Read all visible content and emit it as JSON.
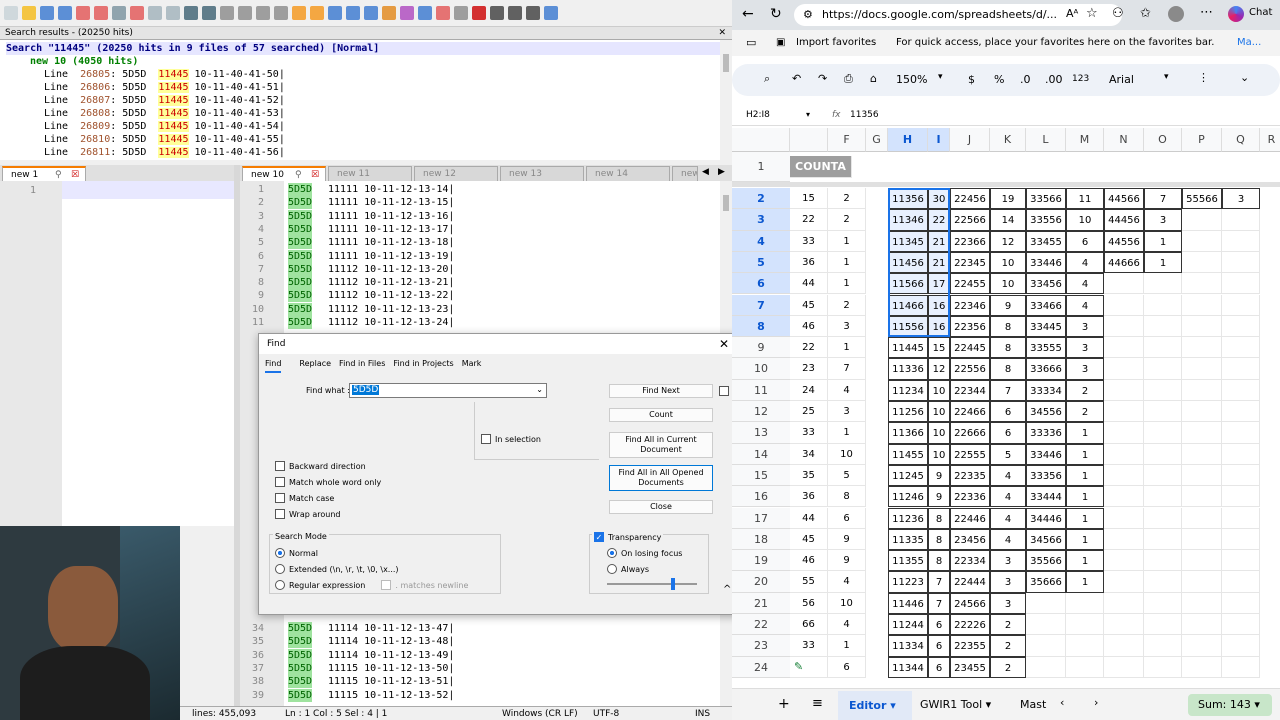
{
  "npp": {
    "search_header": "Search results - (20250 hits)",
    "search_summary": "Search \"11445\" (20250 hits in 9 files of 57 searched) [Normal]",
    "search_file": "new 10 (4050 hits)",
    "search_lines": [
      {
        "ln": "26805",
        "pre": "5D5D",
        "hit": "11445",
        "post": "10-11-40-41-50|"
      },
      {
        "ln": "26806",
        "pre": "5D5D",
        "hit": "11445",
        "post": "10-11-40-41-51|"
      },
      {
        "ln": "26807",
        "pre": "5D5D",
        "hit": "11445",
        "post": "10-11-40-41-52|"
      },
      {
        "ln": "26808",
        "pre": "5D5D",
        "hit": "11445",
        "post": "10-11-40-41-53|"
      },
      {
        "ln": "26809",
        "pre": "5D5D",
        "hit": "11445",
        "post": "10-11-40-41-54|"
      },
      {
        "ln": "26810",
        "pre": "5D5D",
        "hit": "11445",
        "post": "10-11-40-41-55|"
      },
      {
        "ln": "26811",
        "pre": "5D5D",
        "hit": "11445",
        "post": "10-11-40-41-56|"
      }
    ],
    "tabs_left": [
      {
        "label": "new 1"
      }
    ],
    "tabs_right": [
      {
        "label": "new 10"
      },
      {
        "label": "new 11"
      },
      {
        "label": "new 12"
      },
      {
        "label": "new 13"
      },
      {
        "label": "new 14"
      },
      {
        "label": "new"
      }
    ],
    "editor1_line": "1",
    "editor2_top": [
      {
        "n": "1",
        "a": "5D5D",
        "b": "11111 10-11-12-13-14|"
      },
      {
        "n": "2",
        "a": "5D5D",
        "b": "11111 10-11-12-13-15|"
      },
      {
        "n": "3",
        "a": "5D5D",
        "b": "11111 10-11-12-13-16|"
      },
      {
        "n": "4",
        "a": "5D5D",
        "b": "11111 10-11-12-13-17|"
      },
      {
        "n": "5",
        "a": "5D5D",
        "b": "11111 10-11-12-13-18|"
      },
      {
        "n": "6",
        "a": "5D5D",
        "b": "11111 10-11-12-13-19|"
      },
      {
        "n": "7",
        "a": "5D5D",
        "b": "11112 10-11-12-13-20|"
      },
      {
        "n": "8",
        "a": "5D5D",
        "b": "11112 10-11-12-13-21|"
      },
      {
        "n": "9",
        "a": "5D5D",
        "b": "11112 10-11-12-13-22|"
      },
      {
        "n": "10",
        "a": "5D5D",
        "b": "11112 10-11-12-13-23|"
      },
      {
        "n": "11",
        "a": "5D5D",
        "b": "11112 10-11-12-13-24|"
      }
    ],
    "editor2_bottom": [
      {
        "n": "34",
        "a": "5D5D",
        "b": "11114 10-11-12-13-47|"
      },
      {
        "n": "35",
        "a": "5D5D",
        "b": "11114 10-11-12-13-48|"
      },
      {
        "n": "36",
        "a": "5D5D",
        "b": "11114 10-11-12-13-49|"
      },
      {
        "n": "37",
        "a": "5D5D",
        "b": "11115 10-11-12-13-50|"
      },
      {
        "n": "38",
        "a": "5D5D",
        "b": "11115 10-11-12-13-51|"
      },
      {
        "n": "39",
        "a": "5D5D",
        "b": "11115 10-11-12-13-52|"
      }
    ],
    "status": {
      "lines": "lines: 455,093",
      "pos": "Ln : 1    Col : 5    Sel : 4 | 1",
      "eol": "Windows (CR LF)",
      "enc": "UTF-8",
      "mode": "INS"
    }
  },
  "find": {
    "title": "Find",
    "tabs": [
      "Find",
      "Replace",
      "Find in Files",
      "Find in Projects",
      "Mark"
    ],
    "find_what_label": "Find what :",
    "find_what_value": "5D5D",
    "buttons": {
      "find_next": "Find Next",
      "count": "Count",
      "find_all_current": "Find All in Current Document",
      "find_all_opened": "Find All in All Opened Documents",
      "close": "Close"
    },
    "in_selection": "In selection",
    "options": [
      "Backward direction",
      "Match whole word only",
      "Match case",
      "Wrap around"
    ],
    "search_mode_label": "Search Mode",
    "modes": [
      "Normal",
      "Extended (\\n, \\r, \\t, \\0, \\x...)",
      "Regular expression"
    ],
    "matches_newline": ". matches newline",
    "transparency": "Transparency",
    "transparency_opts": [
      "On losing focus",
      "Always"
    ]
  },
  "browser": {
    "url": "https://docs.google.com/spreadsheets/d/...",
    "chat": "Chat",
    "import_favorites": "Import favorites",
    "fav_hint": "For quick access, place your favorites here on the favorites bar.",
    "fav_link": "Ma...",
    "zoom": "150%",
    "currency": "$",
    "percent": "%",
    "dec_down": ".0",
    "dec_up": ".00",
    "num": "123",
    "font": "Arial",
    "name_box": "H2:I8",
    "formula_value": "11356"
  },
  "sheet": {
    "columns": [
      "F",
      "G",
      "H",
      "I",
      "J",
      "K",
      "L",
      "M",
      "N",
      "O",
      "P",
      "Q",
      "R"
    ],
    "header_text": "COUNTA",
    "row_numbers": [
      "1",
      "2",
      "3",
      "4",
      "5",
      "6",
      "7",
      "8",
      "9",
      "10",
      "11",
      "12",
      "13",
      "14",
      "15",
      "16",
      "17",
      "18",
      "19",
      "20",
      "21",
      "22",
      "23",
      "24"
    ],
    "rows": [
      [
        "15",
        "2",
        "11356",
        "30",
        "22456",
        "19",
        "33566",
        "11",
        "44566",
        "7",
        "55566",
        "3"
      ],
      [
        "22",
        "2",
        "11346",
        "22",
        "22566",
        "14",
        "33556",
        "10",
        "44456",
        "3",
        "",
        ""
      ],
      [
        "33",
        "1",
        "11345",
        "21",
        "22366",
        "12",
        "33455",
        "6",
        "44556",
        "1",
        "",
        ""
      ],
      [
        "36",
        "1",
        "11456",
        "21",
        "22345",
        "10",
        "33446",
        "4",
        "44666",
        "1",
        "",
        ""
      ],
      [
        "44",
        "1",
        "11566",
        "17",
        "22455",
        "10",
        "33456",
        "4",
        "",
        "",
        "",
        ""
      ],
      [
        "45",
        "2",
        "11466",
        "16",
        "22346",
        "9",
        "33466",
        "4",
        "",
        "",
        "",
        ""
      ],
      [
        "46",
        "3",
        "11556",
        "16",
        "22356",
        "8",
        "33445",
        "3",
        "",
        "",
        "",
        ""
      ],
      [
        "22",
        "1",
        "11445",
        "15",
        "22445",
        "8",
        "33555",
        "3",
        "",
        "",
        "",
        ""
      ],
      [
        "23",
        "7",
        "11336",
        "12",
        "22556",
        "8",
        "33666",
        "3",
        "",
        "",
        "",
        ""
      ],
      [
        "24",
        "4",
        "11234",
        "10",
        "22344",
        "7",
        "33334",
        "2",
        "",
        "",
        "",
        ""
      ],
      [
        "25",
        "3",
        "11256",
        "10",
        "22466",
        "6",
        "34556",
        "2",
        "",
        "",
        "",
        ""
      ],
      [
        "33",
        "1",
        "11366",
        "10",
        "22666",
        "6",
        "33336",
        "1",
        "",
        "",
        "",
        ""
      ],
      [
        "34",
        "10",
        "11455",
        "10",
        "22555",
        "5",
        "33446",
        "1",
        "",
        "",
        "",
        ""
      ],
      [
        "35",
        "5",
        "11245",
        "9",
        "22335",
        "4",
        "33356",
        "1",
        "",
        "",
        "",
        ""
      ],
      [
        "36",
        "8",
        "11246",
        "9",
        "22336",
        "4",
        "33444",
        "1",
        "",
        "",
        "",
        ""
      ],
      [
        "44",
        "6",
        "11236",
        "8",
        "22446",
        "4",
        "34446",
        "1",
        "",
        "",
        "",
        ""
      ],
      [
        "45",
        "9",
        "11335",
        "8",
        "23456",
        "4",
        "34566",
        "1",
        "",
        "",
        "",
        ""
      ],
      [
        "46",
        "9",
        "11355",
        "8",
        "22334",
        "3",
        "35566",
        "1",
        "",
        "",
        "",
        ""
      ],
      [
        "55",
        "4",
        "11223",
        "7",
        "22444",
        "3",
        "35666",
        "1",
        "",
        "",
        "",
        ""
      ],
      [
        "56",
        "10",
        "11446",
        "7",
        "24566",
        "3",
        "",
        "",
        "",
        "",
        "",
        ""
      ],
      [
        "66",
        "4",
        "11244",
        "6",
        "22226",
        "2",
        "",
        "",
        "",
        "",
        "",
        ""
      ],
      [
        "33",
        "1",
        "11334",
        "6",
        "22355",
        "2",
        "",
        "",
        "",
        "",
        "",
        ""
      ],
      [
        "",
        "6",
        "11344",
        "6",
        "23455",
        "2",
        "",
        "",
        "",
        "",
        "",
        ""
      ]
    ],
    "tabs": [
      "Editor",
      "GWIR1 Tool",
      "Mast"
    ],
    "sum": "Sum: 143"
  }
}
